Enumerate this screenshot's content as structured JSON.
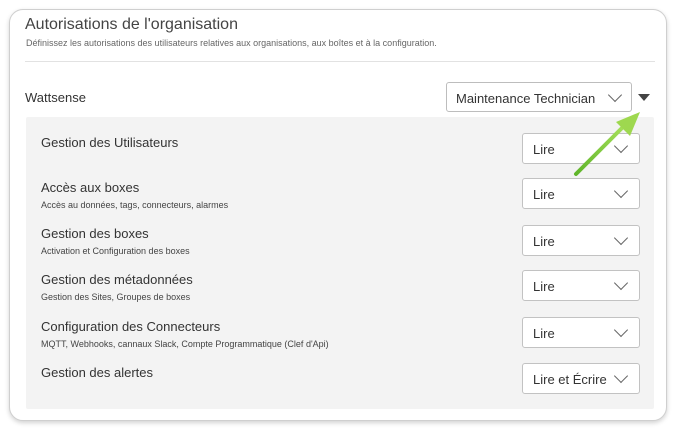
{
  "header": {
    "title": "Autorisations de l'organisation",
    "subtitle": "Définissez les autorisations des utilisateurs relatives aux organisations, aux boîtes et à la configuration."
  },
  "organization": {
    "name": "Wattsense",
    "role_selected": "Maintenance Technician"
  },
  "permissions": [
    {
      "label": "Gestion des Utilisateurs",
      "description": "",
      "value": "Lire"
    },
    {
      "label": "Accès aux boxes",
      "description": "Accès au données, tags, connecteurs, alarmes",
      "value": "Lire"
    },
    {
      "label": "Gestion des boxes",
      "description": "Activation et Configuration des boxes",
      "value": "Lire"
    },
    {
      "label": "Gestion des métadonnées",
      "description": "Gestion des Sites, Groupes de boxes",
      "value": "Lire"
    },
    {
      "label": "Configuration des Connecteurs",
      "description": "MQTT, Webhooks, cannaux Slack, Compte Programmatique (Clef d'Api)",
      "value": "Lire"
    },
    {
      "label": "Gestion des alertes",
      "description": "",
      "value": "Lire et Écrire"
    }
  ],
  "colors": {
    "annotation_arrow": "#8fd13f",
    "panel_bg": "#f3f3f3"
  },
  "icons": {
    "select_chevron": "chevron-down-icon",
    "expand_caret": "caret-down-icon",
    "annotation": "green-arrow-icon"
  }
}
